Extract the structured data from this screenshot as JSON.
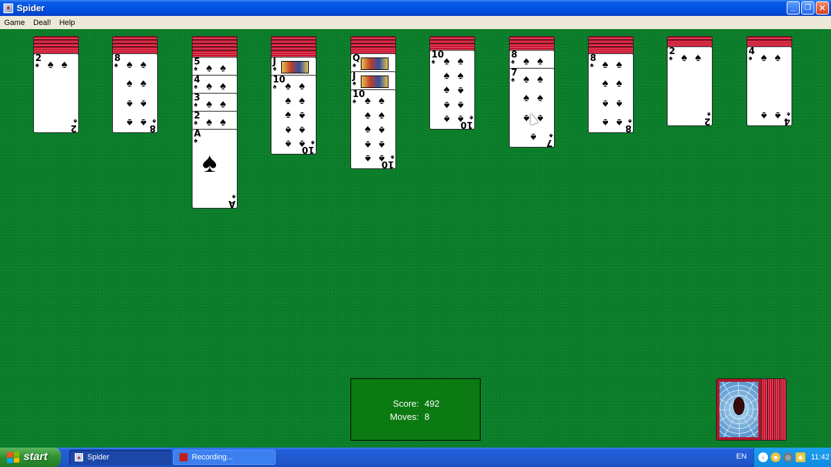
{
  "window": {
    "title": "Spider"
  },
  "menu": [
    "Game",
    "Deal!",
    "Help"
  ],
  "columns": [
    {
      "backs": 4,
      "cards": [
        {
          "rank": "2",
          "suit": "♠",
          "pips": 2
        }
      ]
    },
    {
      "backs": 4,
      "cards": [
        {
          "rank": "8",
          "suit": "♠",
          "pips": 8
        }
      ]
    },
    {
      "backs": 5,
      "cards": [
        {
          "rank": "5",
          "suit": "♠",
          "pips": 5
        },
        {
          "rank": "4",
          "suit": "♠",
          "pips": 4
        },
        {
          "rank": "3",
          "suit": "♠",
          "pips": 3
        },
        {
          "rank": "2",
          "suit": "♠",
          "pips": 2
        },
        {
          "rank": "A",
          "suit": "♠",
          "pips": 1
        }
      ]
    },
    {
      "backs": 5,
      "cards": [
        {
          "rank": "J",
          "suit": "♠",
          "face": true
        },
        {
          "rank": "10",
          "suit": "♠",
          "pips": 10
        }
      ]
    },
    {
      "backs": 4,
      "cards": [
        {
          "rank": "Q",
          "suit": "♠",
          "face": true
        },
        {
          "rank": "J",
          "suit": "♠",
          "face": true
        },
        {
          "rank": "10",
          "suit": "♠",
          "pips": 10
        }
      ]
    },
    {
      "backs": 3,
      "cards": [
        {
          "rank": "10",
          "suit": "♠",
          "pips": 10
        }
      ]
    },
    {
      "backs": 3,
      "cards": [
        {
          "rank": "8",
          "suit": "♠",
          "pips": 8
        },
        {
          "rank": "7",
          "suit": "♠",
          "pips": 7
        }
      ]
    },
    {
      "backs": 4,
      "cards": [
        {
          "rank": "8",
          "suit": "♠",
          "pips": 8
        }
      ]
    },
    {
      "backs": 2,
      "cards": [
        {
          "rank": "2",
          "suit": "♠",
          "pips": 2
        }
      ]
    },
    {
      "backs": 2,
      "cards": [
        {
          "rank": "4",
          "suit": "♠",
          "pips": 4
        }
      ]
    }
  ],
  "score": {
    "score_label": "Score:",
    "score_value": "492",
    "moves_label": "Moves:",
    "moves_value": "8"
  },
  "stock": {
    "remaining_deals": 5
  },
  "taskbar": {
    "start_label": "start",
    "tasks": [
      {
        "label": "Spider",
        "active": true
      },
      {
        "label": "Recording...",
        "active": false
      }
    ],
    "language": "EN",
    "clock": "11:42"
  }
}
